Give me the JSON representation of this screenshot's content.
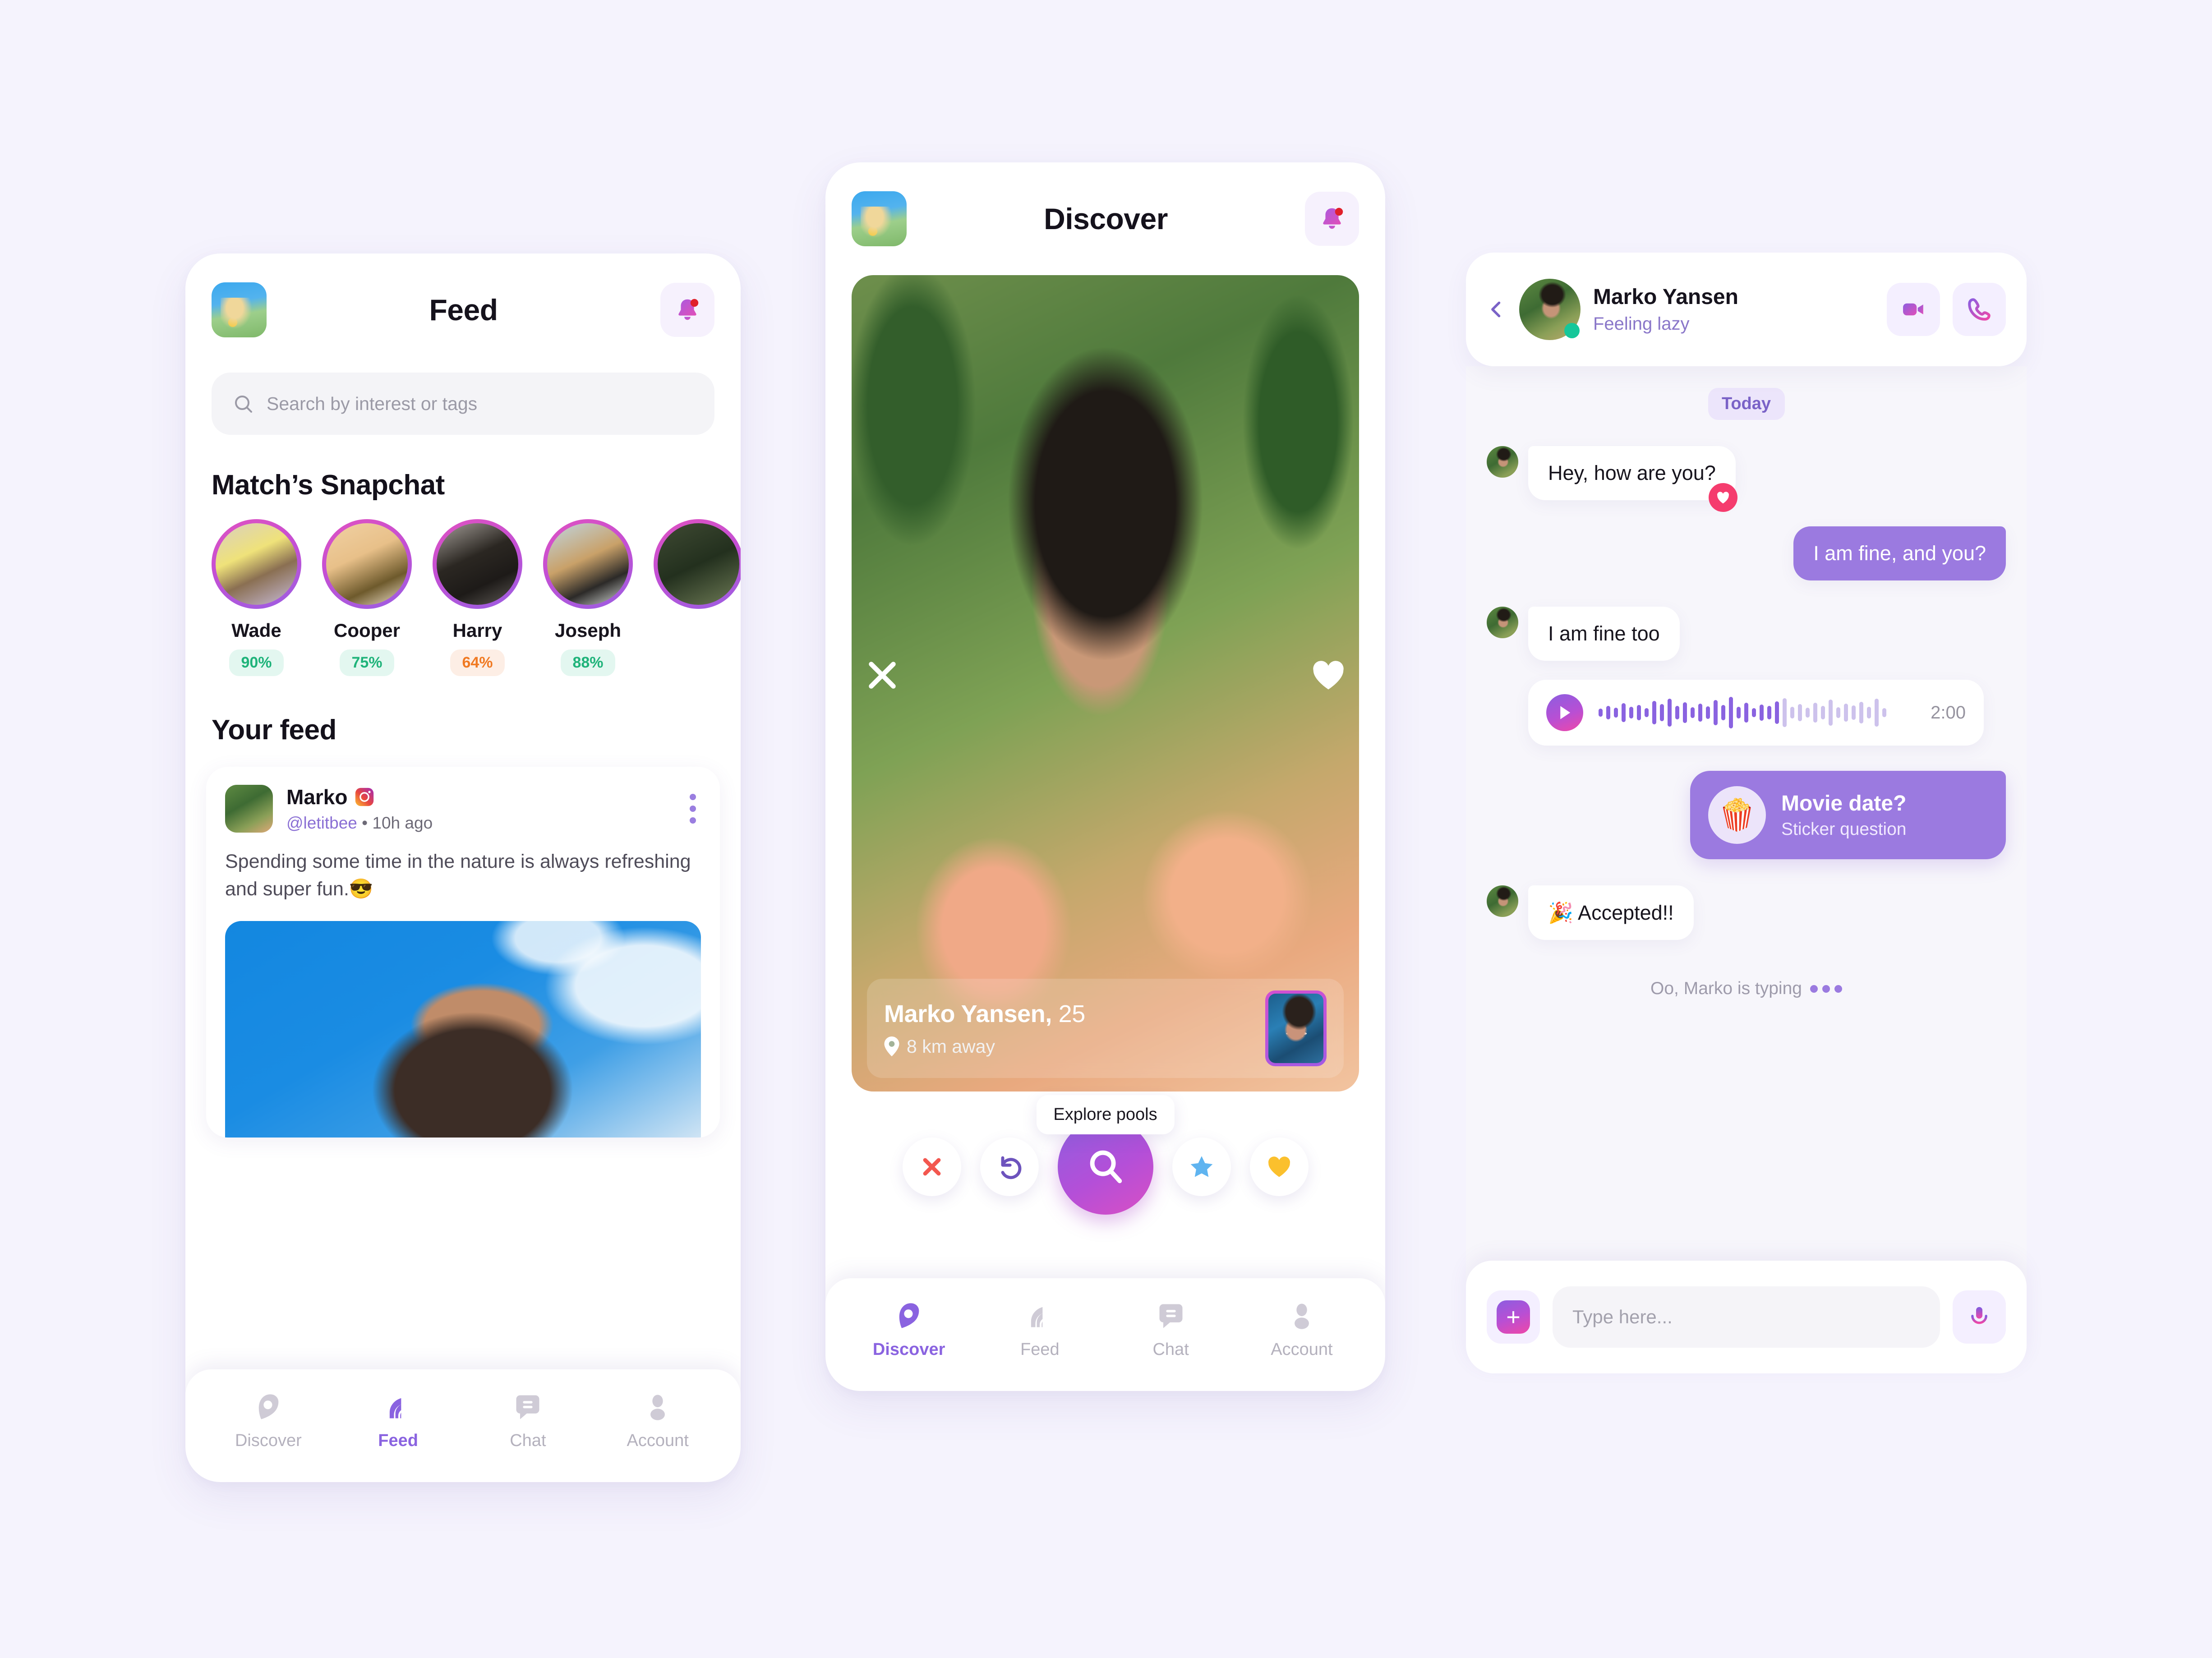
{
  "theme": {
    "page_bg": "#f5f3fd",
    "accent_purple": "#8a63e0",
    "bubble_purple": "#9b7ae0",
    "pink": "#e052c0",
    "green": "#1fb37a",
    "orange": "#f07a23",
    "heart_red": "#f53c6e",
    "online_green": "#16c79a"
  },
  "feed_screen": {
    "header": {
      "title": "Feed",
      "avatar_icon": "user-avatar",
      "notification_icon": "bell-icon",
      "has_unread_badge": true
    },
    "search": {
      "placeholder": "Search by interest or tags",
      "icon": "search-icon"
    },
    "stories_section_title": "Match’s Snapchat",
    "stories": [
      {
        "name": "Wade",
        "match": "90%",
        "tone": "good"
      },
      {
        "name": "Cooper",
        "match": "75%",
        "tone": "good"
      },
      {
        "name": "Harry",
        "match": "64%",
        "tone": "warn"
      },
      {
        "name": "Joseph",
        "match": "88%",
        "tone": "good"
      },
      {
        "name": "",
        "match": "",
        "tone": "good"
      }
    ],
    "feed_section_title": "Your feed",
    "post": {
      "author": "Marko",
      "platform_icon": "instagram-icon",
      "handle": "@letitbee",
      "separator": "•",
      "time": "10h ago",
      "menu_icon": "kebab-menu-icon",
      "text": "Spending some time in the nature is always refreshing and super fun.😎",
      "photo_icon": "post-photo"
    },
    "bottom_nav": {
      "active": "Feed",
      "items": [
        {
          "label": "Discover",
          "icon": "discover-icon"
        },
        {
          "label": "Feed",
          "icon": "feed-icon"
        },
        {
          "label": "Chat",
          "icon": "chat-icon"
        },
        {
          "label": "Account",
          "icon": "account-icon"
        }
      ]
    }
  },
  "discover_screen": {
    "header": {
      "title": "Discover",
      "avatar_icon": "user-avatar",
      "notification_icon": "bell-icon",
      "has_unread_badge": true
    },
    "card": {
      "name": "Marko Yansen,",
      "age": "25",
      "distance": "8 km away",
      "distance_icon": "location-pin-icon",
      "dismiss_icon": "close-icon",
      "like_icon": "heart-icon",
      "snap_badge_icon": "snapchat-ghost-icon"
    },
    "tooltip": "Explore pools",
    "actions": [
      {
        "name": "nope-button",
        "icon": "cross-icon"
      },
      {
        "name": "rewind-button",
        "icon": "undo-icon"
      },
      {
        "name": "explore-button",
        "icon": "search-icon"
      },
      {
        "name": "superlike-button",
        "icon": "star-icon"
      },
      {
        "name": "like-button",
        "icon": "heart-icon"
      }
    ],
    "bottom_nav": {
      "active": "Discover",
      "items": [
        {
          "label": "Discover",
          "icon": "discover-icon"
        },
        {
          "label": "Feed",
          "icon": "feed-icon"
        },
        {
          "label": "Chat",
          "icon": "chat-icon"
        },
        {
          "label": "Account",
          "icon": "account-icon"
        }
      ]
    }
  },
  "chat_screen": {
    "header": {
      "back_icon": "chevron-left-icon",
      "name": "Marko Yansen",
      "status": "Feeling lazy",
      "online": true,
      "video_icon": "video-camera-icon",
      "call_icon": "phone-icon"
    },
    "day_divider": "Today",
    "messages": [
      {
        "side": "in",
        "type": "text",
        "text": "Hey, how are you?",
        "reaction": "heart-icon"
      },
      {
        "side": "out",
        "type": "text",
        "text": "I am fine, and you?"
      },
      {
        "side": "in",
        "type": "text",
        "text": "I am fine too"
      },
      {
        "side": "in",
        "type": "voice",
        "duration": "2:00",
        "play_icon": "play-icon"
      },
      {
        "side": "out",
        "type": "sticker",
        "title": "Movie date?",
        "subtitle": "Sticker question",
        "icon": "popcorn-icon"
      },
      {
        "side": "in",
        "type": "text",
        "text": "🎉 Accepted!!"
      }
    ],
    "typing_indicator": "Oo, Marko is typing",
    "composer": {
      "attach_icon": "plus-icon",
      "placeholder": "Type here...",
      "mic_icon": "microphone-icon"
    }
  }
}
